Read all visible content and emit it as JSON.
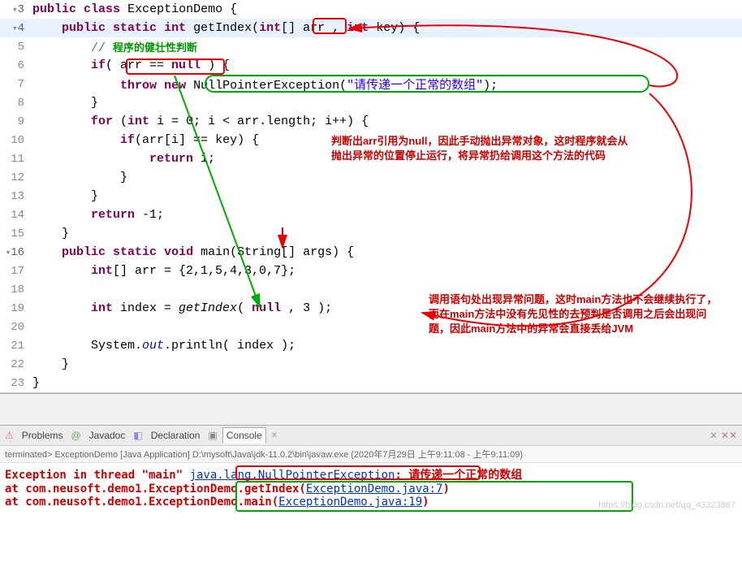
{
  "code": {
    "lines": [
      {
        "n": "3",
        "fold": true
      },
      {
        "n": "4",
        "fold": true,
        "hl": true
      },
      {
        "n": "5"
      },
      {
        "n": "6"
      },
      {
        "n": "7"
      },
      {
        "n": "8"
      },
      {
        "n": "9"
      },
      {
        "n": "10"
      },
      {
        "n": "11"
      },
      {
        "n": "12"
      },
      {
        "n": "13"
      },
      {
        "n": "14"
      },
      {
        "n": "15"
      },
      {
        "n": "16",
        "fold": true
      },
      {
        "n": "17"
      },
      {
        "n": "18"
      },
      {
        "n": "19"
      },
      {
        "n": "20"
      },
      {
        "n": "21"
      },
      {
        "n": "22"
      },
      {
        "n": "23"
      }
    ],
    "l3_kw1": "public",
    "l3_kw2": "class",
    "l3_cls": "ExceptionDemo",
    "l3_brace": " {",
    "l4_kw1": "public",
    "l4_kw2": "static",
    "l4_kw3": "int",
    "l4_meth": "getIndex",
    "l4_p1": "(",
    "l4_kw4": "int",
    "l4_arr": "[] arr , ",
    "l4_kw5": "int",
    "l4_key": " key) {",
    "l5_c": "// ",
    "l5_anno": "程序的健壮性判断",
    "l6_kw1": "if",
    "l6_rest": "( arr == ",
    "l6_kw2": "null",
    "l6_end": " ) {",
    "l7_kw1": "throw",
    "l7_kw2": "new",
    "l7_cls": "NullPointerException",
    "l7_p1": "(",
    "l7_str": "\"请传递一个正常的数组\"",
    "l7_end": ");",
    "l8_b": "}",
    "l9_kw1": "for",
    "l9_p1": " (",
    "l9_kw2": "int",
    "l9_r1": " i = 0; i < arr.length; i++) {",
    "l10_kw1": "if",
    "l10_r1": "(arr[i] == key) {",
    "l11_kw1": "return",
    "l11_r1": " i;",
    "l12_b": "}",
    "l13_b": "}",
    "l14_kw1": "return",
    "l14_r1": " -1;",
    "l15_b": "}",
    "l16_kw1": "public",
    "l16_kw2": "static",
    "l16_kw3": "void",
    "l16_meth": "main",
    "l16_r1": "(String[] args) {",
    "l17_kw1": "int",
    "l17_r1": "[] arr = {2,1,5,4,3,0,7};",
    "l19_kw1": "int",
    "l19_r1": " index = ",
    "l19_meth": "getIndex",
    "l19_r2": "( ",
    "l19_kw2": "null",
    "l19_r3": " , 3 );",
    "l21_r1": "System.",
    "l21_out": "out",
    "l21_r2": ".println( index );",
    "l22_b": "}",
    "l23_b": "}"
  },
  "annotations": {
    "a1": "判断出arr引用为null，因此手动抛出异常对象，这时程序就会从抛出异常的位置停止运行，将异常扔给调用这个方法的代码",
    "a2": "调用语句处出现异常问题，这时main方法也不会继续执行了，而在main方法中没有先见性的去预判是否调用之后会出现问题，因此main方法中的异常会直接丢给JVM"
  },
  "tabs": {
    "problems": "Problems",
    "javadoc": "Javadoc",
    "declaration": "Declaration",
    "console": "Console"
  },
  "terminated": "terminated> ExceptionDemo [Java Application] D:\\mysoft\\Java\\jdk-11.0.2\\bin\\javaw.exe (2020年7月29日 上午9:11:08 - 上午9:11:09)",
  "console": {
    "l1_pre": "Exception in thread \"main\" ",
    "l1_link": "java.lang.NullPointerException",
    "l1_post": ": 请传递一个正常的数组",
    "l2_pre": "\tat com.neusoft.demo1.ExceptionDemo.getIndex(",
    "l2_link": "ExceptionDemo.java:7",
    "l2_post": ")",
    "l3_pre": "\tat com.neusoft.demo1.ExceptionDemo.main(",
    "l3_link": "ExceptionDemo.java:19",
    "l3_post": ")"
  },
  "watermark": "https://blog.csdn.net/qq_43323867"
}
